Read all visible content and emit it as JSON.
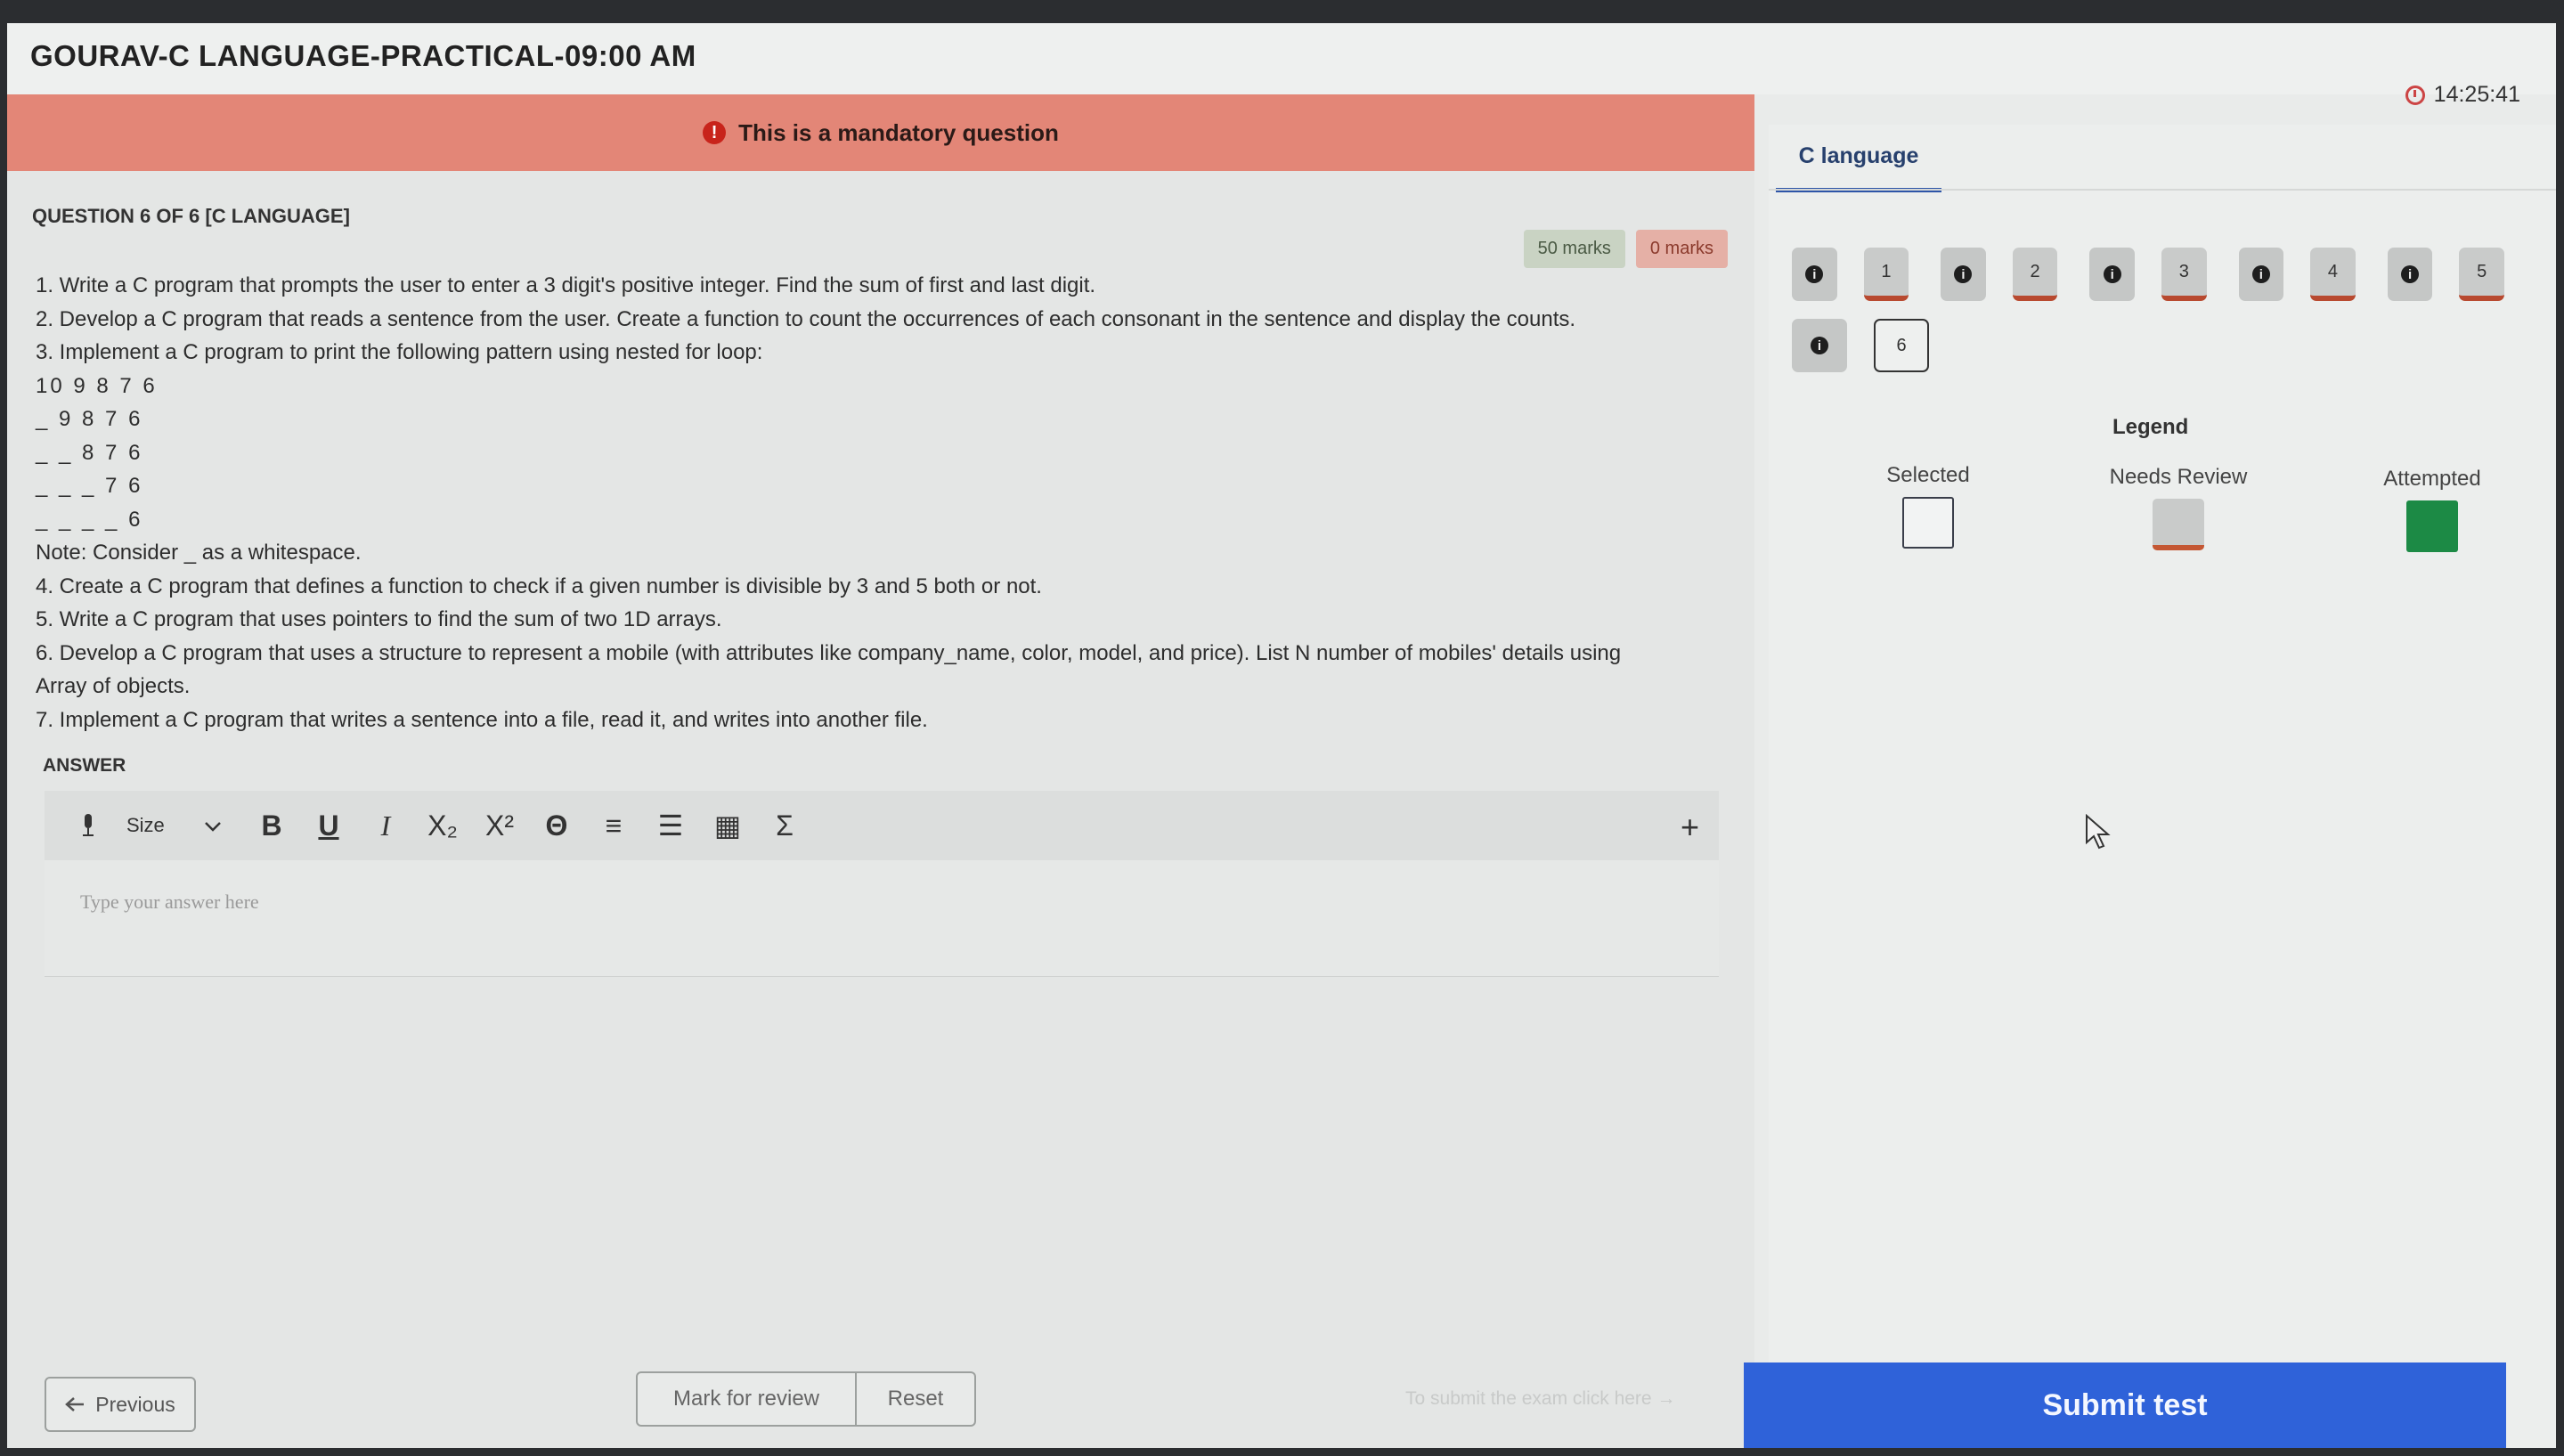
{
  "header": {
    "title": "GOURAV-C LANGUAGE-PRACTICAL-09:00 AM",
    "timer": "14:25:41"
  },
  "banner": {
    "text": "This is a mandatory question"
  },
  "question": {
    "header": "QUESTION 6 OF 6 [C LANGUAGE]",
    "marks_positive": "50 marks",
    "marks_negative": "0 marks",
    "lines": [
      "1. Write a C program that prompts the user to enter a 3 digit's positive integer. Find the sum of first and last digit.",
      "2. Develop a C program that reads a sentence from the user. Create a function to count the occurrences of each consonant in the sentence and display the counts.",
      "3. Implement a C program to print the following pattern using nested for loop:",
      "10 9 8 7 6",
      "_ 9 8 7 6",
      "_ _ 8 7 6",
      "_ _ _ 7 6",
      "_ _ _ _ 6",
      "Note: Consider _ as a whitespace.",
      "4. Create a C program that defines a function to check if a given number is divisible by 3 and 5 both or not.",
      "5. Write a C program that uses pointers to find the sum of two 1D arrays.",
      "6. Develop a C program that uses a structure to represent a mobile (with attributes like company_name, color, model, and price). List N number of mobiles' details using",
      "Array of objects.",
      "7. Implement a C program that writes a sentence into a file, read it, and writes into another file."
    ]
  },
  "answer": {
    "label": "ANSWER",
    "placeholder": "Type your answer here",
    "toolbar": {
      "size_label": "Size",
      "bold": "B",
      "underline": "U",
      "italic": "I",
      "subscript": "X₂",
      "superscript": "X²",
      "special_char": "Θ",
      "align": "≡",
      "list": "☰",
      "table": "▦",
      "sum": "Σ",
      "plus": "+"
    }
  },
  "footer": {
    "previous_label": "Previous",
    "mark_review_label": "Mark for review",
    "reset_label": "Reset",
    "hint": "To submit the exam click here →",
    "submit_label": "Submit test"
  },
  "sidebar": {
    "section_tab": "C language",
    "questions": [
      "1",
      "2",
      "3",
      "4",
      "5",
      "6"
    ],
    "current_question": "6",
    "legend_title": "Legend",
    "legend": {
      "selected": "Selected",
      "needs_review": "Needs Review",
      "attempted": "Attempted"
    },
    "colors": {
      "attempted": "#1c8a45",
      "review_underline": "#c45733",
      "submit": "#2f62d9",
      "banner": "#e38677"
    }
  }
}
